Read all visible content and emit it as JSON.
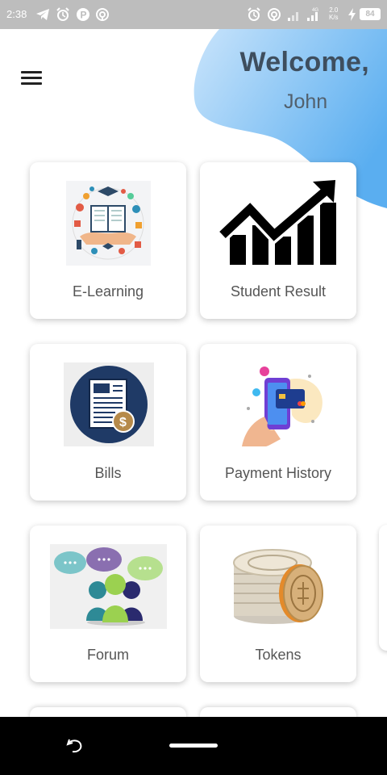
{
  "status_bar": {
    "time": "2:38",
    "speed_value": "2.0",
    "speed_unit": "K/s",
    "battery": "84",
    "network": "4G"
  },
  "header": {
    "title": "Welcome,",
    "user_name": "John"
  },
  "colors": {
    "blob_light": "#bbdcf8",
    "blob_dark": "#5aaef0",
    "title": "#3e4e5e",
    "card_label": "#555555"
  },
  "cards": [
    {
      "label": "E-Learning",
      "icon": "e-learning-icon"
    },
    {
      "label": "Student Result",
      "icon": "growth-chart-icon"
    },
    {
      "label": "Bills",
      "icon": "bill-icon"
    },
    {
      "label": "Payment History",
      "icon": "phone-payment-icon"
    },
    {
      "label": "Forum",
      "icon": "chat-bubbles-icon"
    },
    {
      "label": "Tokens",
      "icon": "coins-icon"
    }
  ]
}
